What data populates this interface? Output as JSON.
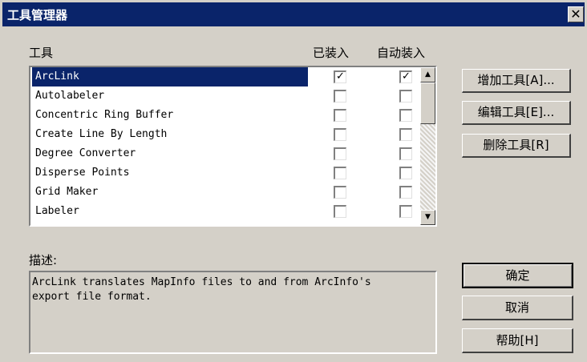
{
  "window": {
    "title": "工具管理器",
    "close_glyph": "✕"
  },
  "columns": {
    "tool": "工具",
    "loaded": "已装入",
    "autoload": "自动装入"
  },
  "tools": [
    {
      "name": "ArcLink",
      "loaded": "✓",
      "autoload": "✓"
    },
    {
      "name": "Autolabeler",
      "loaded": "",
      "autoload": ""
    },
    {
      "name": "Concentric Ring Buffer",
      "loaded": "",
      "autoload": ""
    },
    {
      "name": "Create Line By Length",
      "loaded": "",
      "autoload": ""
    },
    {
      "name": "Degree Converter",
      "loaded": "",
      "autoload": ""
    },
    {
      "name": "Disperse Points",
      "loaded": "",
      "autoload": ""
    },
    {
      "name": "Grid Maker",
      "loaded": "",
      "autoload": ""
    },
    {
      "name": "Labeler",
      "loaded": "",
      "autoload": ""
    }
  ],
  "selected_tool": "ArcLink",
  "scroll": {
    "up_glyph": "▲",
    "down_glyph": "▼"
  },
  "buttons": {
    "add_tool": "增加工具[A]...",
    "edit_tool": "编辑工具[E]...",
    "delete_tool": "删除工具[R]",
    "ok": "确定",
    "cancel": "取消",
    "help": "帮助[H]"
  },
  "description": {
    "label": "描述:",
    "text": "ArcLink translates MapInfo files to and from ArcInfo's\nexport file format."
  }
}
